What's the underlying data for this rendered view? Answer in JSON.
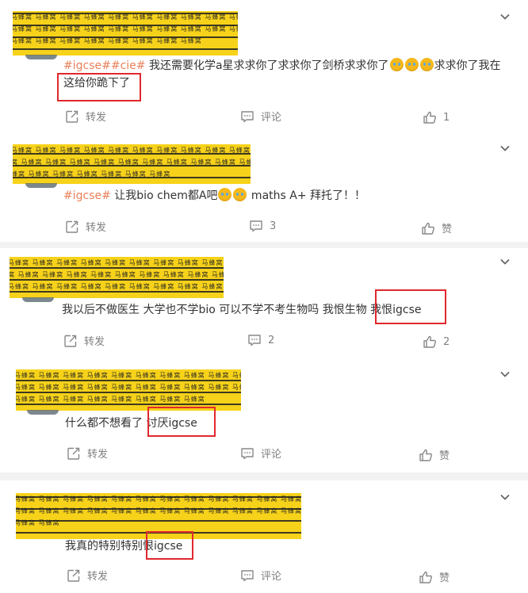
{
  "colors": {
    "tag": "#e8805a",
    "highlight": "#e0282e",
    "redaction": "#f7d21a",
    "action_text": "#808080"
  },
  "icons": {
    "collapse": "chevron-down-icon",
    "forward": "share-icon",
    "comment": "comment-icon",
    "like": "thumbs-up-icon"
  },
  "redaction_watermark": "马蜂窝 马蜂窝 马蜂窝 马蜂窝 马蜂窝 马蜂窝 马蜂窝 马蜂窝 马蜂窝 马蜂窝 马蜂窝 马蜂窝 马蜂窝 马蜂窝 马蜂窝 马蜂窝 马蜂窝 马蜂窝 马蜂窝 马蜂窝 马蜂窝 马蜂窝 马蜂窝 马蜂窝 马蜂窝 马蜂窝 马蜂窝 马蜂窝 马蜂窝 马蜂窝",
  "posts": [
    {
      "tags": "#igcse##cie#",
      "text_a": " 我还需要化学a星求求你了求求你了剑桥求求你了",
      "text_b": "求求你了我在",
      "text_c": "这给你跪下了",
      "forward": "转发",
      "comment": "评论",
      "like": "1"
    },
    {
      "tags": "#igcse#",
      "text_a": " 让我bio chem都A吧",
      "text_b": " maths A+ 拜托了！！",
      "forward": "转发",
      "comment": "3",
      "like": "赞"
    },
    {
      "text_a": "我以后不做医生 大学也不学bio 可以不学不考生物吗 我恨生物 ",
      "text_b": "我恨igcse",
      "forward": "转发",
      "comment": "2",
      "like": "2"
    },
    {
      "text_a": "什么都不想看了 ",
      "text_b": "讨厌igcse",
      "forward": "转发",
      "comment": "评论",
      "like": "赞"
    },
    {
      "text_a": "我真的特别特别恨igcse",
      "forward": "转发",
      "comment": "评论",
      "like": "赞"
    }
  ]
}
